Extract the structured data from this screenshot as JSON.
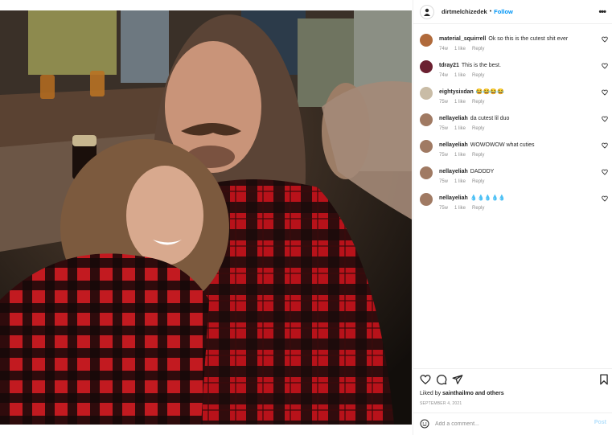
{
  "post": {
    "username": "dirtmelchizedek",
    "separator": "•",
    "follow_label": "Follow",
    "more_label": "•••",
    "photo_alt_icon": "photo",
    "liked_by_prefix": "Liked by",
    "liked_by_user": "sainthailmo",
    "liked_by_suffix": "and others",
    "date": "SEPTEMBER 4, 2021",
    "add_comment_placeholder": "Add a comment...",
    "post_label": "Post"
  },
  "comments": [
    {
      "username": "material_squirrell",
      "text": "Ok so this is the cutest shit ever",
      "age": "74w",
      "likes": "1 like",
      "reply": "Reply",
      "avatar_color": "#b06a3b"
    },
    {
      "username": "tdray21",
      "text": "This is the best.",
      "age": "74w",
      "likes": "1 like",
      "reply": "Reply",
      "avatar_color": "#6b2030"
    },
    {
      "username": "eightysixdan",
      "text": "😂😂😂😂",
      "age": "75w",
      "likes": "1 like",
      "reply": "Reply",
      "avatar_color": "#c9bca6"
    },
    {
      "username": "nellayeliah",
      "text": "da cutest lil duo",
      "age": "75w",
      "likes": "1 like",
      "reply": "Reply",
      "avatar_color": "#a07a63"
    },
    {
      "username": "nellayeliah",
      "text": "WOWOWOW what cuties",
      "age": "75w",
      "likes": "1 like",
      "reply": "Reply",
      "avatar_color": "#a07a63"
    },
    {
      "username": "nellayeliah",
      "text": "DADDDY",
      "age": "75w",
      "likes": "1 like",
      "reply": "Reply",
      "avatar_color": "#a07a63"
    },
    {
      "username": "nellayeliah",
      "text": "💧💧💧💧💧",
      "age": "75w",
      "likes": "1 like",
      "reply": "Reply",
      "avatar_color": "#a07a63"
    }
  ],
  "icons": {
    "heart": "heart-icon",
    "comment": "comment-icon",
    "share": "share-icon",
    "save": "bookmark-icon",
    "emoji": "emoji-icon",
    "more": "more-icon"
  },
  "colors": {
    "accent": "#0095f6",
    "post_disabled": "#b2dffc",
    "muted": "#8e8e8e",
    "text": "#262626"
  }
}
